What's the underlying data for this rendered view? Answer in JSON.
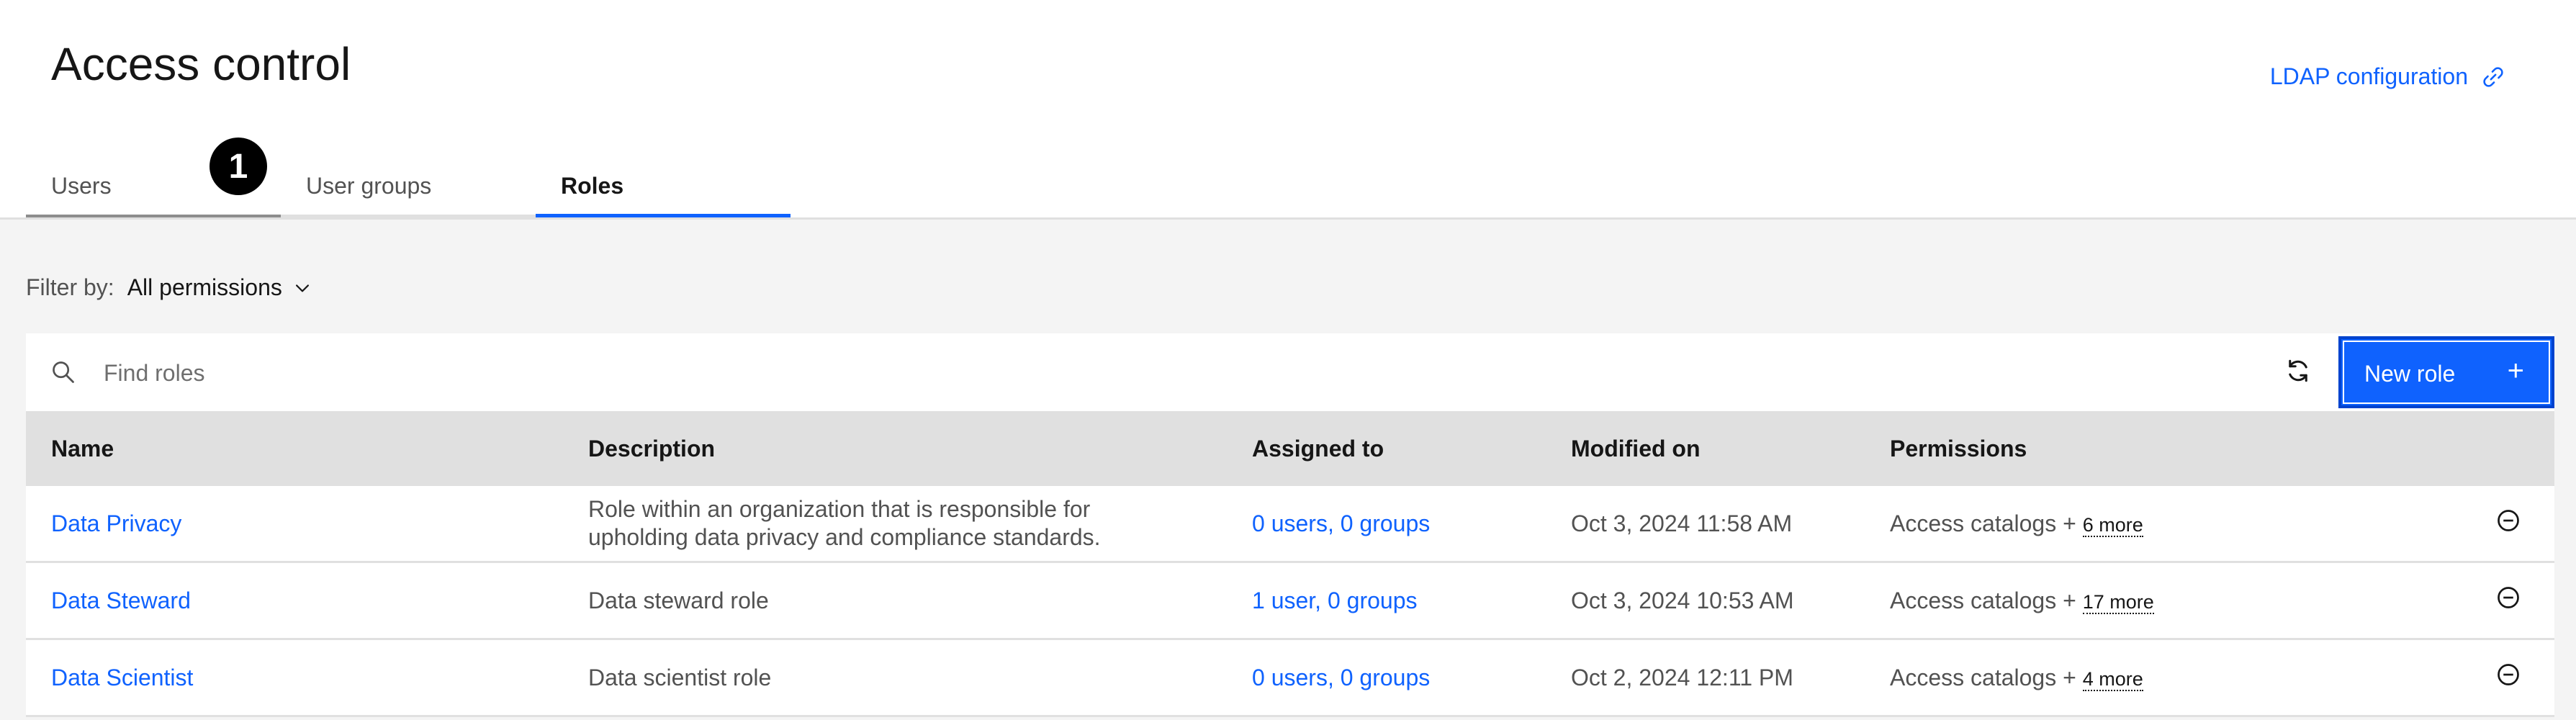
{
  "header": {
    "title": "Access control",
    "ldap_link": "LDAP configuration"
  },
  "tabs": [
    {
      "label": "Users"
    },
    {
      "label": "User groups"
    },
    {
      "label": "Roles"
    }
  ],
  "step_badge": "1",
  "filter": {
    "label": "Filter by:",
    "value": "All permissions"
  },
  "search": {
    "placeholder": "Find roles"
  },
  "toolbar": {
    "new_role_label": "New role",
    "plus": "+"
  },
  "table": {
    "headers": [
      "Name",
      "Description",
      "Assigned to",
      "Modified on",
      "Permissions"
    ],
    "rows": [
      {
        "name": "Data Privacy",
        "description_line1": "Role within an organization that is responsible for",
        "description_line2": "upholding data privacy and compliance standards.",
        "assigned_users": "0 users",
        "assigned_groups": "0 groups",
        "modified": "Oct 3, 2024 11:58 AM",
        "permissions": "Access catalogs +",
        "permissions_more": "6 more"
      },
      {
        "name": "Data Steward",
        "description_line1": "Data steward role",
        "description_line2": "",
        "assigned_users": "1 user",
        "assigned_groups": "0 groups",
        "modified": "Oct 3, 2024 10:53 AM",
        "permissions": "Access catalogs +",
        "permissions_more": "17 more"
      },
      {
        "name": "Data Scientist",
        "description_line1": "Data scientist role",
        "description_line2": "",
        "assigned_users": "0 users",
        "assigned_groups": "0 groups",
        "modified": "Oct 2, 2024 12:11 PM",
        "permissions": "Access catalogs +",
        "permissions_more": "4 more"
      }
    ]
  },
  "colors": {
    "accent": "#0f62fe",
    "table_header": "#e0e0e0",
    "content_bg": "#f4f4f4"
  },
  "icons": [
    "launch-icon",
    "chevron-down-icon",
    "search-icon",
    "refresh-icon",
    "add-icon",
    "remove-icon"
  ]
}
